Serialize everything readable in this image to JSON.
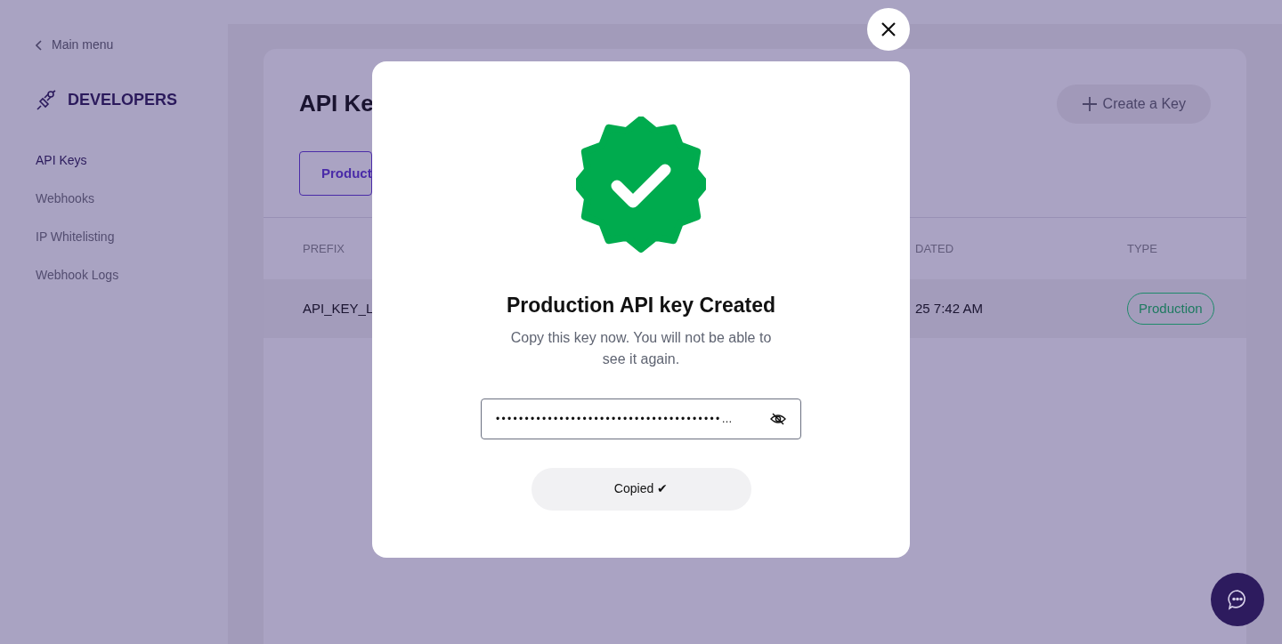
{
  "sidebar": {
    "back_link": "Main menu",
    "section_title": "DEVELOPERS",
    "items": [
      {
        "label": "API Keys",
        "selected": true
      },
      {
        "label": "Webhooks",
        "selected": false
      },
      {
        "label": "IP Whitelisting",
        "selected": false
      },
      {
        "label": "Webhook Logs",
        "selected": false
      }
    ]
  },
  "page": {
    "title": "API Ke",
    "create_button": "Create a Key",
    "tabs": [
      {
        "label": "Product",
        "selected": true
      }
    ],
    "table": {
      "columns": [
        "PREFIX",
        "DATED",
        "TYPE"
      ],
      "rows": [
        {
          "prefix": "API_KEY_L",
          "updated": "25 7:42 AM",
          "type": "Production"
        }
      ]
    }
  },
  "modal": {
    "title": "Production API key Created",
    "message": "Copy this key now. You will not be able to see it again.",
    "key_field": {
      "value": "•••••••••••••••••••••••••••••••••••••••…"
    },
    "copy_button": "Copied ✔"
  }
}
